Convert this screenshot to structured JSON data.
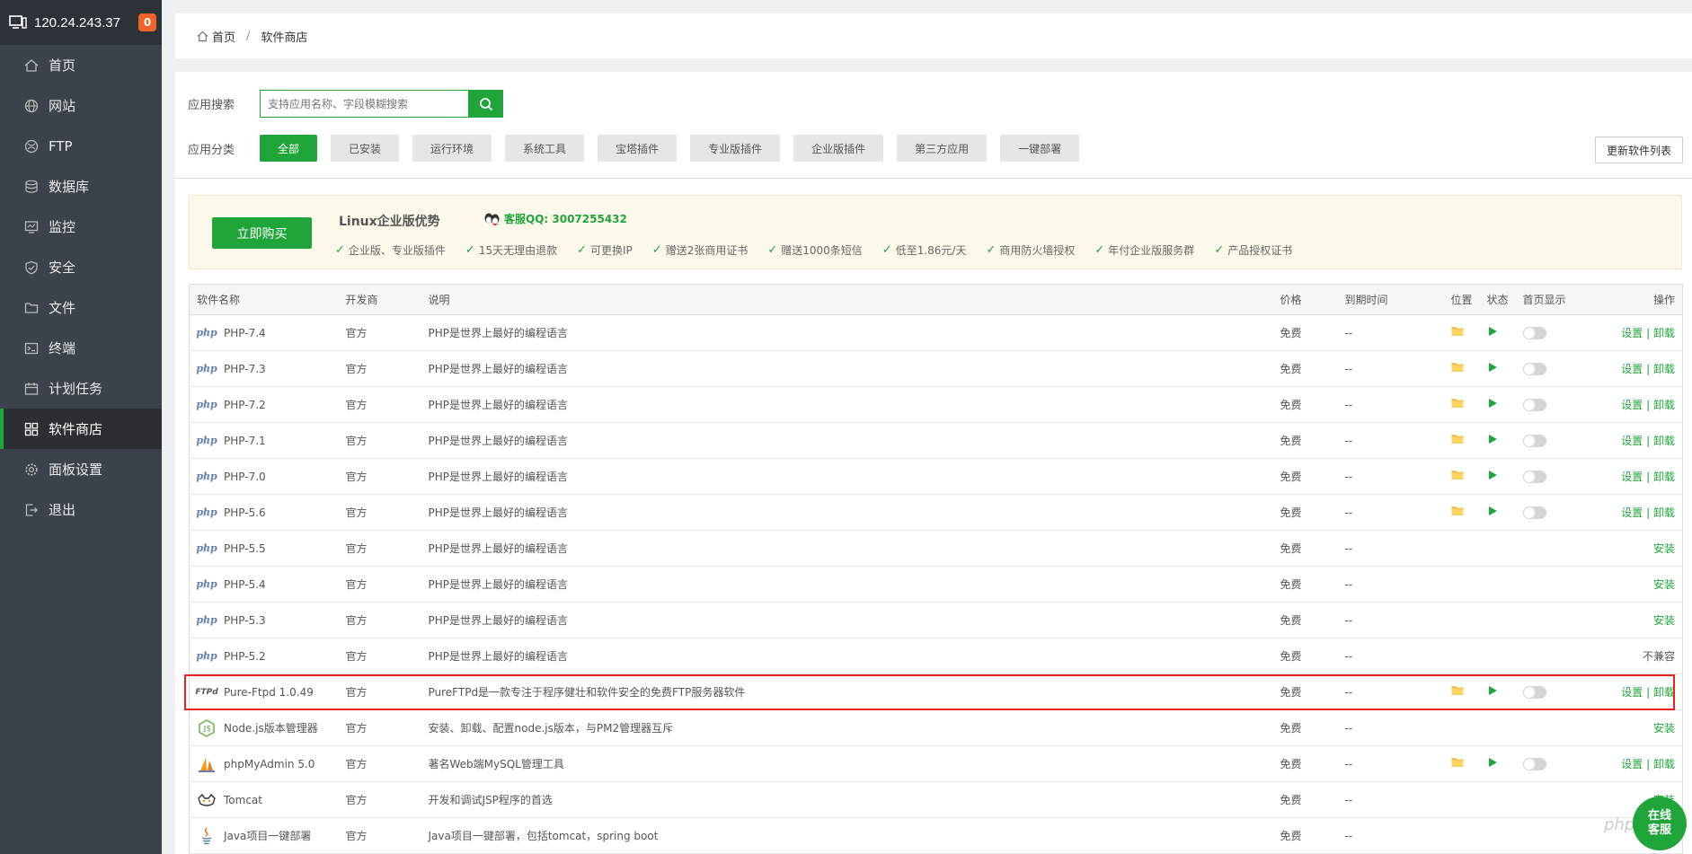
{
  "sidebar": {
    "ip": "120.24.243.37",
    "badge": "0",
    "items": [
      {
        "label": "首页",
        "icon": "home-icon"
      },
      {
        "label": "网站",
        "icon": "globe-icon"
      },
      {
        "label": "FTP",
        "icon": "ftp-icon"
      },
      {
        "label": "数据库",
        "icon": "database-icon"
      },
      {
        "label": "监控",
        "icon": "monitor-icon"
      },
      {
        "label": "安全",
        "icon": "shield-icon"
      },
      {
        "label": "文件",
        "icon": "folder-icon"
      },
      {
        "label": "终端",
        "icon": "terminal-icon"
      },
      {
        "label": "计划任务",
        "icon": "calendar-icon"
      },
      {
        "label": "软件商店",
        "icon": "grid-icon",
        "active": true
      },
      {
        "label": "面板设置",
        "icon": "gear-icon"
      },
      {
        "label": "退出",
        "icon": "logout-icon"
      }
    ]
  },
  "breadcrumb": {
    "home": "首页",
    "sep": "/",
    "current": "软件商店"
  },
  "search": {
    "label": "应用搜索",
    "placeholder": "支持应用名称、字段模糊搜索"
  },
  "categories": {
    "label": "应用分类",
    "items": [
      "全部",
      "已安装",
      "运行环境",
      "系统工具",
      "宝塔插件",
      "专业版插件",
      "企业版插件",
      "第三方应用",
      "一键部署"
    ]
  },
  "refresh_label": "更新软件列表",
  "ad": {
    "buy_label": "立即购买",
    "title": "Linux企业版优势",
    "qq": "客服QQ: 3007255432",
    "features": [
      "企业版、专业版插件",
      "15天无理由退款",
      "可更换IP",
      "赠送2张商用证书",
      "赠送1000条短信",
      "低至1.86元/天",
      "商用防火墙授权",
      "年付企业版服务群",
      "产品授权证书"
    ]
  },
  "table": {
    "headers": {
      "name": "软件名称",
      "dev": "开发商",
      "desc": "说明",
      "price": "价格",
      "expire": "到期时间",
      "location": "位置",
      "status": "状态",
      "home": "首页显示",
      "ops": "操作"
    },
    "rows": [
      {
        "name": "PHP-7.4",
        "icon": "php",
        "dev": "官方",
        "desc": "PHP是世界上最好的编程语言",
        "price": "免费",
        "expire": "--",
        "installed": true
      },
      {
        "name": "PHP-7.3",
        "icon": "php",
        "dev": "官方",
        "desc": "PHP是世界上最好的编程语言",
        "price": "免费",
        "expire": "--",
        "installed": true
      },
      {
        "name": "PHP-7.2",
        "icon": "php",
        "dev": "官方",
        "desc": "PHP是世界上最好的编程语言",
        "price": "免费",
        "expire": "--",
        "installed": true
      },
      {
        "name": "PHP-7.1",
        "icon": "php",
        "dev": "官方",
        "desc": "PHP是世界上最好的编程语言",
        "price": "免费",
        "expire": "--",
        "installed": true
      },
      {
        "name": "PHP-7.0",
        "icon": "php",
        "dev": "官方",
        "desc": "PHP是世界上最好的编程语言",
        "price": "免费",
        "expire": "--",
        "installed": true
      },
      {
        "name": "PHP-5.6",
        "icon": "php",
        "dev": "官方",
        "desc": "PHP是世界上最好的编程语言",
        "price": "免费",
        "expire": "--",
        "installed": true
      },
      {
        "name": "PHP-5.5",
        "icon": "php",
        "dev": "官方",
        "desc": "PHP是世界上最好的编程语言",
        "price": "免费",
        "expire": "--",
        "action": "安装"
      },
      {
        "name": "PHP-5.4",
        "icon": "php",
        "dev": "官方",
        "desc": "PHP是世界上最好的编程语言",
        "price": "免费",
        "expire": "--",
        "action": "安装"
      },
      {
        "name": "PHP-5.3",
        "icon": "php",
        "dev": "官方",
        "desc": "PHP是世界上最好的编程语言",
        "price": "免费",
        "expire": "--",
        "action": "安装"
      },
      {
        "name": "PHP-5.2",
        "icon": "php",
        "dev": "官方",
        "desc": "PHP是世界上最好的编程语言",
        "price": "免费",
        "expire": "--",
        "action": "不兼容"
      },
      {
        "name": "Pure-Ftpd 1.0.49",
        "icon": "ftp",
        "dev": "官方",
        "desc": "PureFTPd是一款专注于程序健壮和软件安全的免费FTP服务器软件",
        "price": "免费",
        "expire": "--",
        "installed": true
      },
      {
        "name": "Node.js版本管理器",
        "icon": "node",
        "dev": "官方",
        "desc": "安装、卸载、配置node.js版本，与PM2管理器互斥",
        "price": "免费",
        "expire": "--",
        "action": "安装"
      },
      {
        "name": "phpMyAdmin 5.0",
        "icon": "pma",
        "dev": "官方",
        "desc": "著名Web端MySQL管理工具",
        "price": "免费",
        "expire": "--",
        "installed": true
      },
      {
        "name": "Tomcat",
        "icon": "tomcat",
        "dev": "官方",
        "desc": "开发和调试JSP程序的首选",
        "price": "免费",
        "expire": "--",
        "action": "安装"
      },
      {
        "name": "Java项目一键部署",
        "icon": "java",
        "dev": "官方",
        "desc": "Java项目一键部署，包括tomcat，spring boot",
        "price": "免费",
        "expire": "--",
        "action": ""
      }
    ],
    "set_label": "设置",
    "pipe": "|",
    "uninstall_label": "卸载"
  },
  "php_icon_text": "php",
  "ftp_icon_text": "FTPd",
  "chat": {
    "line1": "在线",
    "line2": "客服"
  },
  "watermark": "php",
  "colors": {
    "accent": "#20a53a",
    "sidebar": "#3b4249",
    "highlight": "#e82222"
  }
}
